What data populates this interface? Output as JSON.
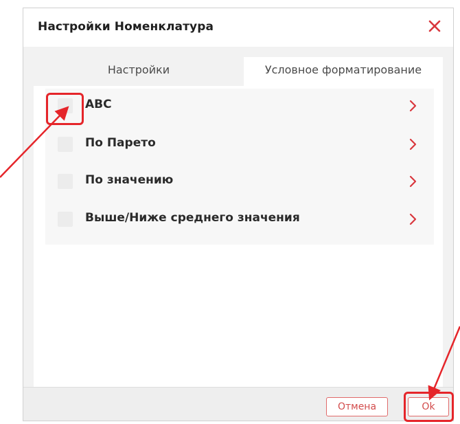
{
  "dialog": {
    "title": "Настройки Номенклатура",
    "close_icon": "close-icon"
  },
  "tabs": [
    {
      "label": "Настройки",
      "active": false
    },
    {
      "label": "Условное форматирование",
      "active": true
    }
  ],
  "formatting_options": [
    {
      "label": "ABC",
      "checked": false
    },
    {
      "label": "По Парето",
      "checked": false
    },
    {
      "label": "По значению",
      "checked": false
    },
    {
      "label": "Выше/Ниже среднего значения",
      "checked": false
    }
  ],
  "footer": {
    "cancel_label": "Отмена",
    "ok_label": "Ok"
  },
  "colors": {
    "accent": "#d24b4b",
    "annotation": "#e5252a",
    "close": "#d9373d"
  },
  "icons": {
    "row_chevron": "chevron-right-icon",
    "annotation_arrow": "arrow-annotation"
  }
}
